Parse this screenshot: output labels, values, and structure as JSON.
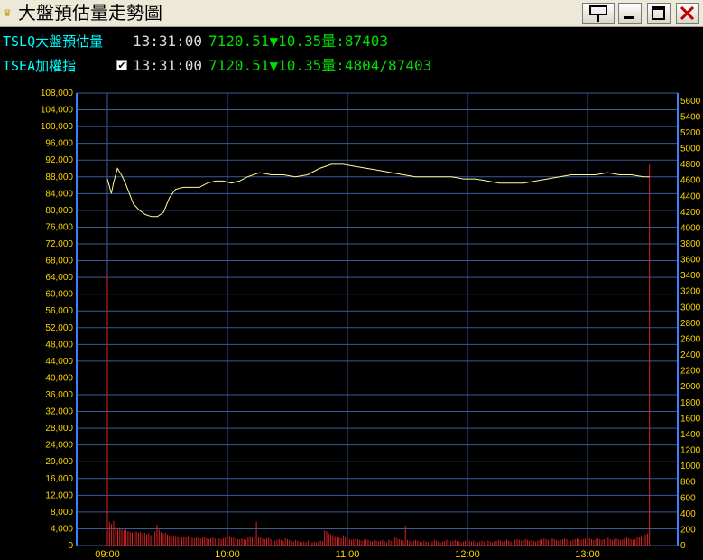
{
  "window": {
    "title": "大盤預估量走勢圖",
    "buttons": [
      "pin-icon",
      "minimize-icon",
      "maximize-icon",
      "close-icon"
    ]
  },
  "quotes": [
    {
      "name": "TSLQ大盤預估量",
      "time": "13:31:00",
      "price": "7120.51",
      "arrow": "▼",
      "change": "10.35",
      "volume": "量:87403"
    },
    {
      "name": "TSEA加權指",
      "checked": true,
      "time": "13:31:00",
      "price": "7120.51",
      "arrow": "▼",
      "change": "10.35",
      "volume": "量:4804/87403"
    }
  ],
  "colors": {
    "background": "#000000",
    "grid": "#3a5a9a",
    "line": "#ffff99",
    "bars": "#dd2222",
    "ticks": "#ffd700",
    "green": "#00e000",
    "cyan": "#00ffff"
  },
  "chart_data": {
    "type": "line",
    "left_axis": {
      "ticks": [
        "108,000",
        "104,000",
        "100,000",
        "96,000",
        "92,000",
        "88,000",
        "84,000",
        "80,000",
        "76,000",
        "72,000",
        "68,000",
        "64,000",
        "60,000",
        "56,000",
        "52,000",
        "48,000",
        "44,000",
        "40,000",
        "36,000",
        "32,000",
        "28,000",
        "24,000",
        "20,000",
        "16,000",
        "12,000",
        "8,000",
        "4,000",
        "0"
      ],
      "ylim": [
        0,
        108000
      ]
    },
    "right_axis": {
      "ticks": [
        "5600",
        "5400",
        "5200",
        "5000",
        "4800",
        "4600",
        "4400",
        "4200",
        "4000",
        "3800",
        "3600",
        "3400",
        "3200",
        "3000",
        "2800",
        "2600",
        "2400",
        "2200",
        "2000",
        "1800",
        "1600",
        "1400",
        "1200",
        "1000",
        "800",
        "600",
        "400",
        "200",
        "0"
      ],
      "ylim": [
        0,
        5700
      ]
    },
    "x_ticks": [
      "09:00",
      "10:00",
      "11:00",
      "12:00",
      "13:00"
    ],
    "x_range_min": [
      0,
      271
    ],
    "series": [
      {
        "points": [
          [
            0,
            87500
          ],
          [
            2,
            84000
          ],
          [
            3,
            86500
          ],
          [
            5,
            90000
          ],
          [
            7,
            88500
          ],
          [
            9,
            86500
          ],
          [
            11,
            84000
          ],
          [
            13,
            81500
          ],
          [
            16,
            80000
          ],
          [
            19,
            79000
          ],
          [
            22,
            78500
          ],
          [
            25,
            78500
          ],
          [
            28,
            79500
          ],
          [
            31,
            83000
          ],
          [
            34,
            85000
          ],
          [
            38,
            85500
          ],
          [
            42,
            85500
          ],
          [
            46,
            85500
          ],
          [
            50,
            86500
          ],
          [
            54,
            87000
          ],
          [
            58,
            87000
          ],
          [
            62,
            86500
          ],
          [
            66,
            87000
          ],
          [
            70,
            88000
          ],
          [
            76,
            89000
          ],
          [
            82,
            88500
          ],
          [
            88,
            88500
          ],
          [
            94,
            88000
          ],
          [
            100,
            88500
          ],
          [
            106,
            90000
          ],
          [
            112,
            91000
          ],
          [
            118,
            91000
          ],
          [
            124,
            90500
          ],
          [
            130,
            90000
          ],
          [
            136,
            89500
          ],
          [
            142,
            89000
          ],
          [
            148,
            88500
          ],
          [
            154,
            88000
          ],
          [
            160,
            88000
          ],
          [
            166,
            88000
          ],
          [
            172,
            88000
          ],
          [
            178,
            87500
          ],
          [
            184,
            87500
          ],
          [
            190,
            87000
          ],
          [
            196,
            86500
          ],
          [
            202,
            86500
          ],
          [
            208,
            86500
          ],
          [
            214,
            87000
          ],
          [
            220,
            87500
          ],
          [
            226,
            88000
          ],
          [
            232,
            88500
          ],
          [
            238,
            88500
          ],
          [
            244,
            88500
          ],
          [
            250,
            89000
          ],
          [
            256,
            88500
          ],
          [
            262,
            88500
          ],
          [
            268,
            88000
          ],
          [
            271,
            88000
          ]
        ]
      },
      {
        "bars": [
          3400,
          300,
          270,
          310,
          240,
          210,
          220,
          200,
          190,
          200,
          180,
          170,
          160,
          180,
          170,
          160,
          170,
          150,
          160,
          140,
          150,
          130,
          140,
          180,
          260,
          200,
          170,
          150,
          160,
          140,
          130,
          120,
          130,
          120,
          110,
          120,
          100,
          110,
          100,
          120,
          110,
          100,
          90,
          110,
          100,
          90,
          100,
          110,
          90,
          80,
          90,
          100,
          90,
          80,
          90,
          80,
          90,
          100,
          110,
          120,
          110,
          100,
          90,
          80,
          80,
          90,
          80,
          70,
          100,
          120,
          110,
          100,
          300,
          110,
          100,
          90,
          80,
          90,
          100,
          80,
          70,
          60,
          70,
          80,
          70,
          60,
          90,
          80,
          70,
          60,
          50,
          70,
          60,
          50,
          40,
          50,
          40,
          60,
          50,
          40,
          50,
          40,
          50,
          60,
          50,
          190,
          180,
          150,
          140,
          130,
          120,
          110,
          100,
          90,
          130,
          110,
          90,
          80,
          70,
          80,
          90,
          80,
          70,
          60,
          70,
          80,
          70,
          60,
          50,
          70,
          60,
          50,
          60,
          70,
          50,
          40,
          70,
          60,
          50,
          100,
          90,
          80,
          70,
          60,
          250,
          70,
          60,
          50,
          60,
          70,
          60,
          50,
          40,
          60,
          50,
          40,
          60,
          50,
          70,
          60,
          50,
          40,
          50,
          60,
          70,
          60,
          50,
          60,
          70,
          60,
          50,
          40,
          50,
          60,
          70,
          60,
          50,
          60,
          50,
          40,
          50,
          60,
          50,
          40,
          60,
          50,
          40,
          50,
          60,
          70,
          60,
          50,
          60,
          70,
          60,
          50,
          60,
          70,
          80,
          70,
          60,
          70,
          80,
          70,
          60,
          70,
          60,
          50,
          60,
          70,
          80,
          90,
          80,
          70,
          80,
          90,
          80,
          70,
          60,
          70,
          80,
          90,
          80,
          70,
          60,
          70,
          80,
          90,
          80,
          70,
          80,
          90,
          100,
          90,
          80,
          70,
          80,
          90,
          80,
          70,
          80,
          90,
          100,
          80,
          70,
          80,
          90,
          80,
          70,
          80,
          90,
          100,
          90,
          80,
          70,
          80,
          100,
          110,
          120,
          130,
          140,
          150,
          4804
        ]
      }
    ]
  }
}
